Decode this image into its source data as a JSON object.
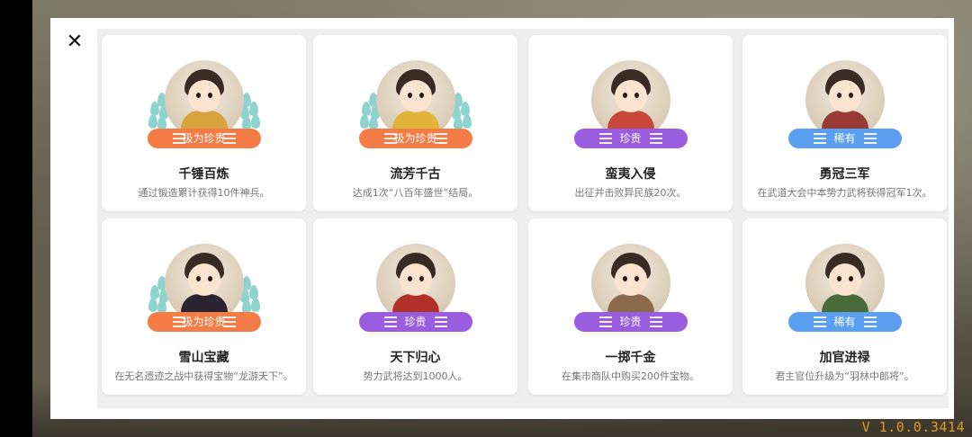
{
  "version": "V 1.0.0.3414",
  "modal": {
    "close_icon": "close-icon"
  },
  "rarity_colors": {
    "极为珍贵": "#f47c46",
    "珍贵": "#9b5de0",
    "稀有": "#5b9ff0"
  },
  "achievements": [
    {
      "title": "千锤百炼",
      "desc": "通过锻造累计获得10件神兵。",
      "rarity": "极为珍贵",
      "laurel": true,
      "robe": "#d8a23c"
    },
    {
      "title": "流芳千古",
      "desc": "达成1次“八百年盛世”结局。",
      "rarity": "极为珍贵",
      "laurel": true,
      "robe": "#e0b436"
    },
    {
      "title": "蛮夷入侵",
      "desc": "出征并击败异民族20次。",
      "rarity": "珍贵",
      "laurel": false,
      "robe": "#c8463a"
    },
    {
      "title": "勇冠三军",
      "desc": "在武道大会中本势力武将获得冠军1次。",
      "rarity": "稀有",
      "laurel": false,
      "robe": "#9a3a36"
    },
    {
      "title": "雪山宝藏",
      "desc": "在无名遗迹之战中获得宝物“龙游天下”。",
      "rarity": "极为珍贵",
      "laurel": true,
      "robe": "#2b2430"
    },
    {
      "title": "天下归心",
      "desc": "势力武将达到1000人。",
      "rarity": "珍贵",
      "laurel": false,
      "robe": "#b0302a"
    },
    {
      "title": "一掷千金",
      "desc": "在集市商队中购买200件宝物。",
      "rarity": "珍贵",
      "laurel": false,
      "robe": "#8a6a4a"
    },
    {
      "title": "加官进禄",
      "desc": "君主官位升级为“羽林中郎将”。",
      "rarity": "稀有",
      "laurel": false,
      "robe": "#4a6a3a"
    }
  ]
}
